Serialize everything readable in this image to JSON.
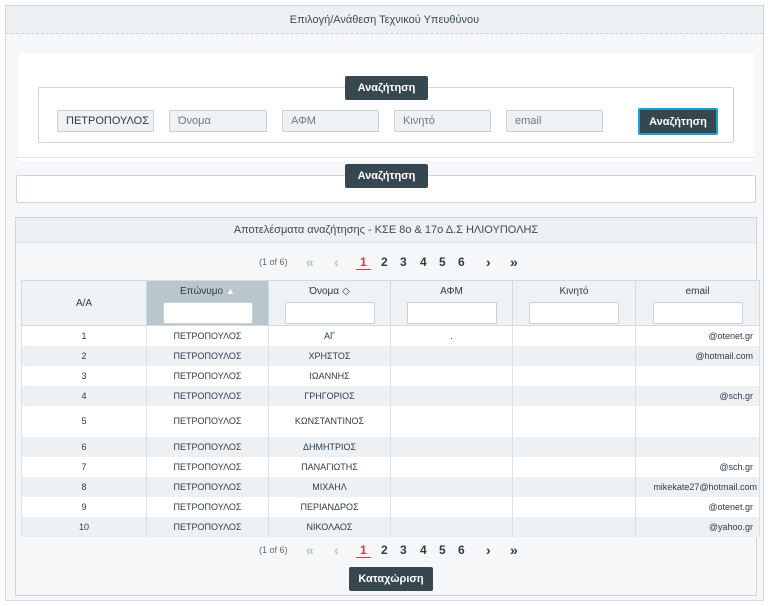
{
  "panel_title": "Επιλογή/Ανάθεση Τεχνικού Υπευθύνου",
  "search": {
    "legend": "Αναζήτηση",
    "surname_value": "ΠΕΤΡΟΠΟΥΛΟΣ",
    "name_placeholder": "Όνομα",
    "afm_placeholder": "ΑΦΜ",
    "mobile_placeholder": "Κινητό",
    "email_placeholder": "email",
    "go_label": "Αναζήτηση"
  },
  "secondary_search_label": "Αναζήτηση",
  "results": {
    "title": "Αποτελέσματα αναζήτησης - ΚΣΕ 8ο & 17ο Δ.Σ ΗΛΙΟΥΠΟΛΗΣ",
    "pager": {
      "count": "(1 of 6)",
      "first": "«",
      "prev": "‹",
      "next": "›",
      "last": "»",
      "pages": [
        "1",
        "2",
        "3",
        "4",
        "5",
        "6"
      ],
      "current": "1"
    },
    "columns": {
      "aa": "Α/Α",
      "surname": "Επώνυμο",
      "name": "Όνομα",
      "afm": "ΑΦΜ",
      "mobile": "Κινητό",
      "email": "email"
    },
    "rows": [
      {
        "aa": "1",
        "surname": "ΠΕΤΡΟΠΟΥΛΟΣ",
        "name": "ΑΓ",
        "afm": ".",
        "mobile": "",
        "email": "@otenet.gr"
      },
      {
        "aa": "2",
        "surname": "ΠΕΤΡΟΠΟΥΛΟΣ",
        "name": "ΧΡΗΣΤΟΣ",
        "afm": "",
        "mobile": "",
        "email": "@hotmail.com"
      },
      {
        "aa": "3",
        "surname": "ΠΕΤΡΟΠΟΥΛΟΣ",
        "name": "ΙΩΑΝΝΗΣ",
        "afm": "",
        "mobile": "",
        "email": ""
      },
      {
        "aa": "4",
        "surname": "ΠΕΤΡΟΠΟΥΛΟΣ",
        "name": "ΓΡΗΓΟΡΙΟΣ",
        "afm": "",
        "mobile": "",
        "email": "@sch.gr"
      },
      {
        "aa": "5",
        "surname": "ΠΕΤΡΟΠΟΥΛΟΣ",
        "name": "ΚΩΝΣΤΑΝΤΙΝΟΣ",
        "afm": "",
        "mobile": "",
        "email": ""
      },
      {
        "aa": "6",
        "surname": "ΠΕΤΡΟΠΟΥΛΟΣ",
        "name": "ΔΗΜΗΤΡΙΟΣ",
        "afm": "",
        "mobile": "",
        "email": ""
      },
      {
        "aa": "7",
        "surname": "ΠΕΤΡΟΠΟΥΛΟΣ",
        "name": "ΠΑΝΑΓΙΩΤΗΣ",
        "afm": "",
        "mobile": "",
        "email": "@sch.gr"
      },
      {
        "aa": "8",
        "surname": "ΠΕΤΡΟΠΟΥΛΟΣ",
        "name": "ΜΙΧΑΗΛ",
        "afm": "",
        "mobile": "",
        "email": "mikekate27@hotmail.com"
      },
      {
        "aa": "9",
        "surname": "ΠΕΤΡΟΠΟΥΛΟΣ",
        "name": "ΠΕΡΙΑΝΔΡΟΣ",
        "afm": "",
        "mobile": "",
        "email": "@otenet.gr"
      },
      {
        "aa": "10",
        "surname": "ΠΕΤΡΟΠΟΥΛΟΣ",
        "name": "ΝΙΚΟΛΑΟΣ",
        "afm": "",
        "mobile": "",
        "email": "@yahoo.gr"
      }
    ]
  },
  "submit_label": "Καταχώριση",
  "colors": {
    "button_bg": "#36474f",
    "button_focus_border": "#1b9fd1",
    "current_page": "#d0383c",
    "sorted_header": "#b9c6cc"
  },
  "icons": {
    "sort_up": "caret-up-icon",
    "sortable": "sort-both-icon"
  }
}
